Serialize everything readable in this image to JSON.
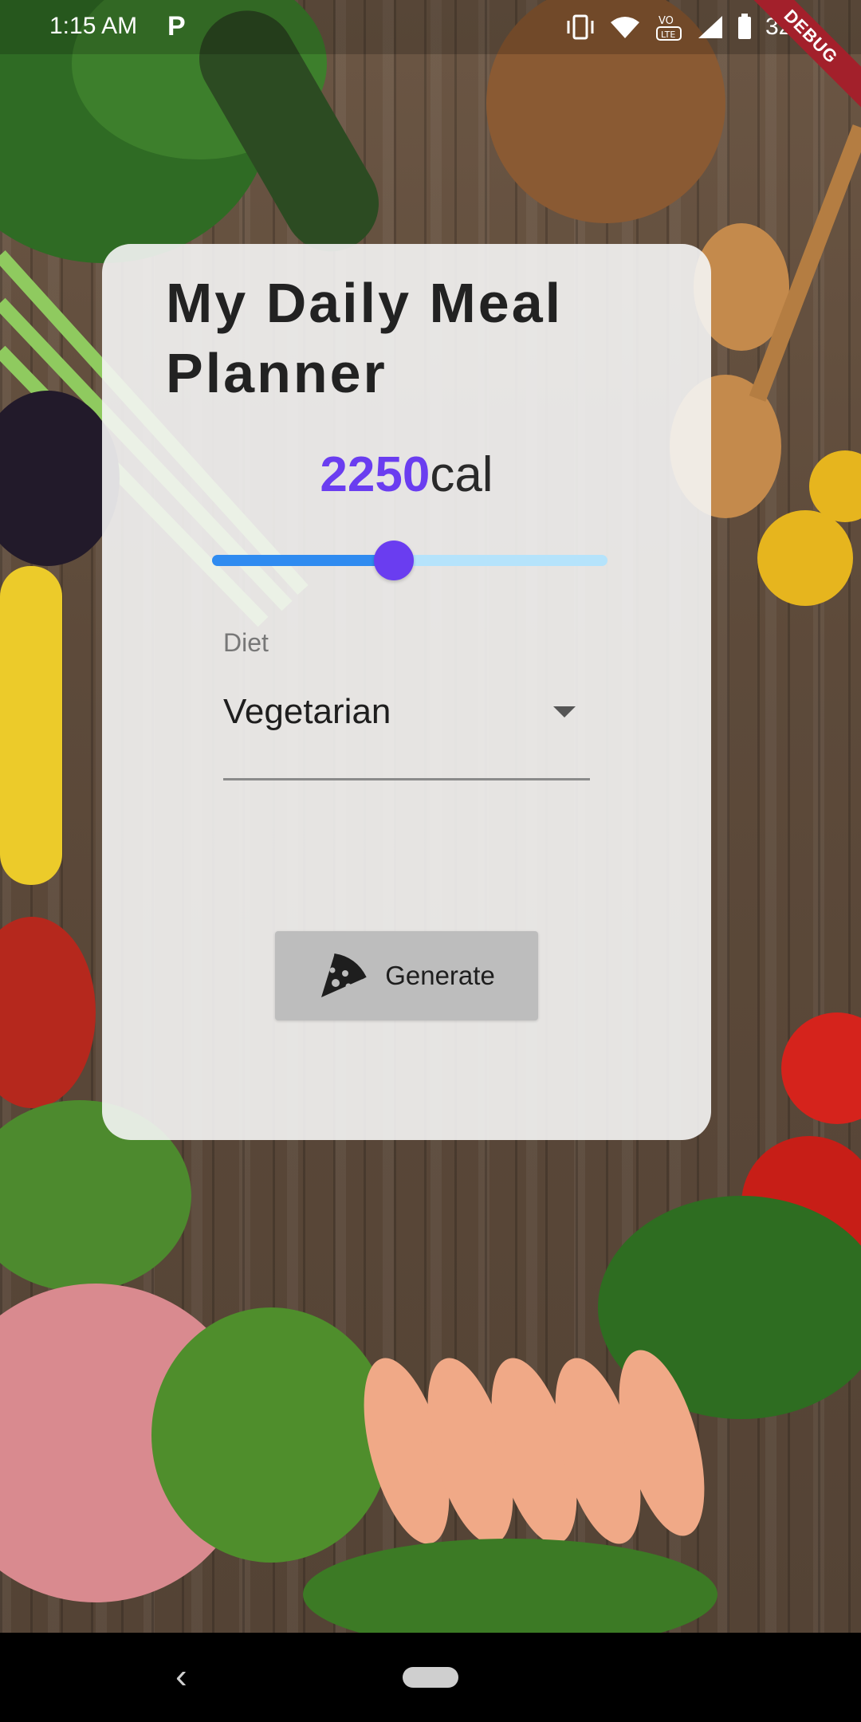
{
  "status_bar": {
    "time": "1:15 AM",
    "app_indicator": "P",
    "battery_percent": "32%",
    "debug_banner": "DEBUG",
    "icons": [
      "vibrate-icon",
      "wifi-icon",
      "volte-icon",
      "signal-icon",
      "battery-icon"
    ]
  },
  "card": {
    "title": "My Daily Meal Planner",
    "calories": {
      "value": "2250",
      "unit": "cal",
      "slider_fraction": 0.46
    },
    "diet": {
      "label": "Diet",
      "selected": "Vegetarian"
    },
    "generate_button": {
      "label": "Generate",
      "icon": "pizza-icon"
    }
  },
  "nav_bar": {
    "back_icon": "‹"
  },
  "colors": {
    "accent": "#6a3df0",
    "slider_active": "#2f8bf0",
    "slider_inactive": "#b5e3fb",
    "button_bg": "#bdbdbd"
  }
}
